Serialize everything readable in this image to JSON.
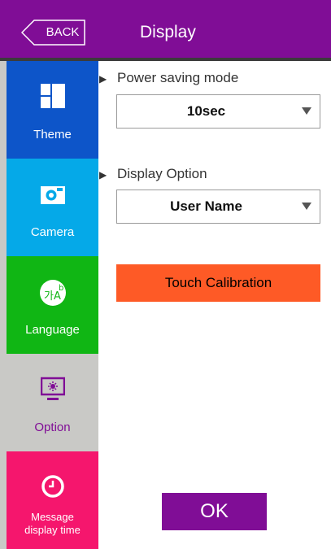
{
  "header": {
    "back_label": "BACK",
    "title": "Display"
  },
  "sidebar": {
    "items": [
      {
        "label": "Theme",
        "icon": "theme-grid-icon"
      },
      {
        "label": "Camera",
        "icon": "camera-icon"
      },
      {
        "label": "Language",
        "icon": "language-icon",
        "icon_text": "가A",
        "icon_sup": "b"
      },
      {
        "label": "Option",
        "icon": "monitor-icon",
        "selected": true
      },
      {
        "label_line1": "Message",
        "label_line2": "display time",
        "icon": "clock-icon"
      }
    ]
  },
  "main": {
    "power_saving": {
      "label": "Power saving mode",
      "value": "10sec"
    },
    "display_option": {
      "label": "Display Option",
      "value": "User Name"
    },
    "touch_calibration_label": "Touch Calibration",
    "ok_label": "OK"
  },
  "colors": {
    "header": "#800d96",
    "theme": "#0d55c9",
    "camera": "#05a9e8",
    "language": "#10b614",
    "option_bg": "#c9c9c6",
    "message": "#f5166d",
    "touch_button": "#fe5a26"
  }
}
